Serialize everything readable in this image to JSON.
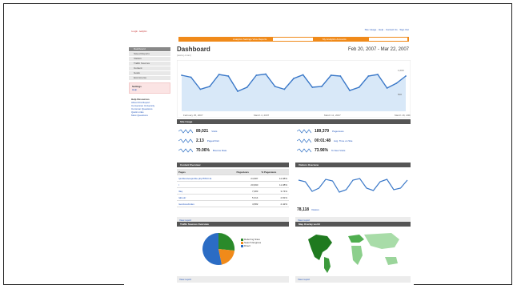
{
  "app": {
    "logo_text": "Google",
    "logo_tag": "Analytics",
    "top_links": "Site Usage · Help · Contact Us · Sign Out",
    "accent_color": "#f08a1a"
  },
  "topbar": {
    "left_label": "Analytics Settings  View Reports",
    "right_label": "My Analytics Accounts"
  },
  "sidebar": {
    "items": [
      {
        "label": "Dashboard",
        "active": true
      },
      {
        "label": "Saved Reports"
      },
      {
        "label": "Visitors"
      },
      {
        "label": "Traffic Sources"
      },
      {
        "label": "Content"
      },
      {
        "label": "Goals"
      },
      {
        "label": "Ecommerce"
      }
    ],
    "settings_title": "Settings",
    "settings_link": "Help",
    "resources_title": "Help Resources",
    "resources": [
      "About this Report",
      "Conversion University",
      "Common Questions",
      "Quick Links",
      "Most Questions"
    ]
  },
  "header": {
    "title": "Dashboard",
    "subtitle": "(www.j-l.com)",
    "date_range": "Feb 20, 2007 - Mar 22, 2007"
  },
  "chart_data": {
    "type": "line",
    "values": [
      90,
      85,
      55,
      62,
      92,
      88,
      50,
      60,
      90,
      93,
      62,
      55,
      82,
      91,
      60,
      62,
      90,
      88,
      52,
      60,
      88,
      92,
      58,
      70,
      88
    ],
    "ylim": [
      0,
      120
    ],
    "y_ticks": [
      "1,000",
      "500"
    ],
    "x_ticks": [
      "February 25, 2007",
      "March 4, 2007",
      "March 11, 2007",
      "March 18, 2007"
    ]
  },
  "site_usage": {
    "title": "Site Usage",
    "left": [
      {
        "value": "89,021",
        "label": "Visits"
      },
      {
        "value": "2.13",
        "label": "Pages/Visit"
      },
      {
        "value": "70.06%",
        "label": "Bounce Rate"
      }
    ],
    "right": [
      {
        "value": "189,379",
        "label": "Pageviews"
      },
      {
        "value": "00:01:48",
        "label": "Avg. Time on Site"
      },
      {
        "value": "73.96%",
        "label": "% New Visits"
      }
    ]
  },
  "content_overview": {
    "title": "Content Overview",
    "columns": [
      "Pages",
      "Pageviews",
      "% Pageviews"
    ],
    "rows": [
      [
        "/profile/viewprofile.php?PID=11",
        "24,587",
        "12.98%"
      ],
      [
        "/",
        "20,990",
        "11.08%"
      ],
      [
        "/faq",
        "7,083",
        "3.74%"
      ],
      [
        "/about/",
        "5,314",
        "2.81%"
      ],
      [
        "/services/index",
        "4,582",
        "2.42%"
      ]
    ],
    "view_report": "View report"
  },
  "visitors_overview": {
    "title": "Visitors Overview",
    "visits_value": "78,118",
    "visits_label": "Visitors",
    "view_report": "View report"
  },
  "traffic_sources": {
    "title": "Traffic Sources Overview",
    "legend": [
      {
        "label": "Referring Sites",
        "color": "#2a8a2a"
      },
      {
        "label": "Search Engines",
        "color": "#f08a1a"
      },
      {
        "label": "Direct",
        "color": "#2b6cc4"
      }
    ],
    "view_report": "View report"
  },
  "map_overlay": {
    "title": "Map Overlay world",
    "view_report": "View report"
  }
}
